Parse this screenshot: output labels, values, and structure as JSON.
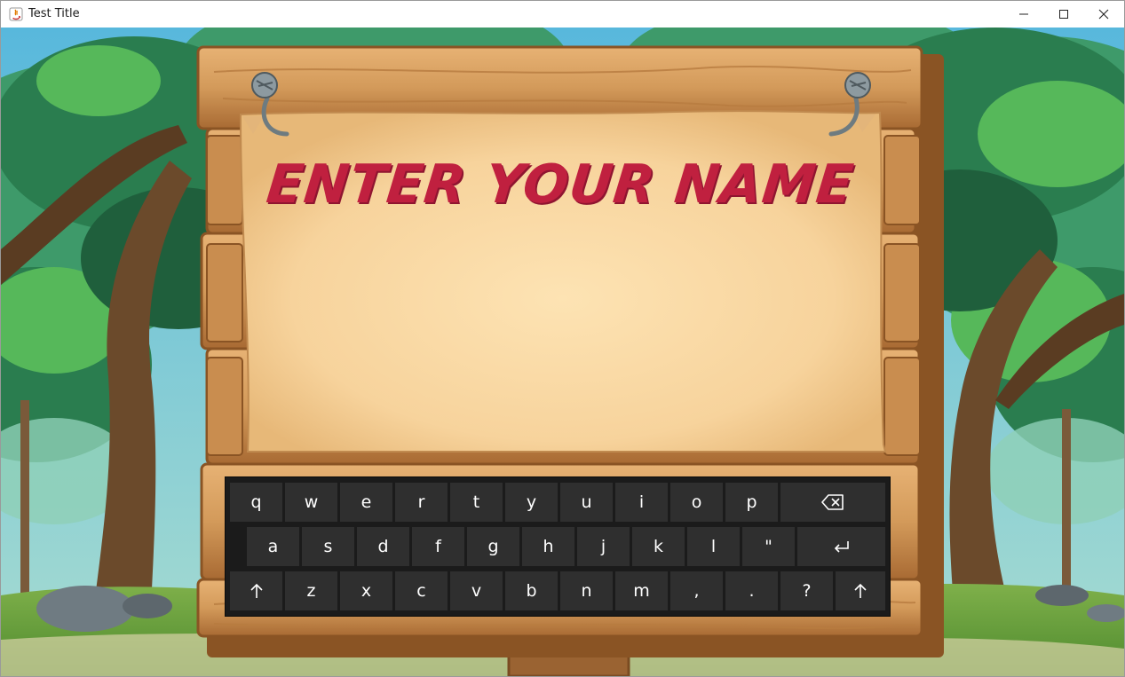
{
  "window": {
    "title": "Test Title",
    "controls": [
      "minimize",
      "maximize",
      "close"
    ]
  },
  "board": {
    "heading": "ENTER YOUR NAME",
    "heading_color": "#c0203f",
    "name_value": ""
  },
  "keyboard": {
    "row1": [
      "q",
      "w",
      "e",
      "r",
      "t",
      "y",
      "u",
      "i",
      "o",
      "p"
    ],
    "row2": [
      "a",
      "s",
      "d",
      "f",
      "g",
      "h",
      "j",
      "k",
      "l",
      "\""
    ],
    "row3": [
      "z",
      "x",
      "c",
      "v",
      "b",
      "n",
      "m",
      ",",
      ".",
      "?"
    ],
    "special_icons": [
      "backspace-icon",
      "enter-icon",
      "shift-left-icon",
      "shift-right-icon"
    ],
    "key_color": "#2f2f2f",
    "background_color": "#1b1b1b"
  }
}
